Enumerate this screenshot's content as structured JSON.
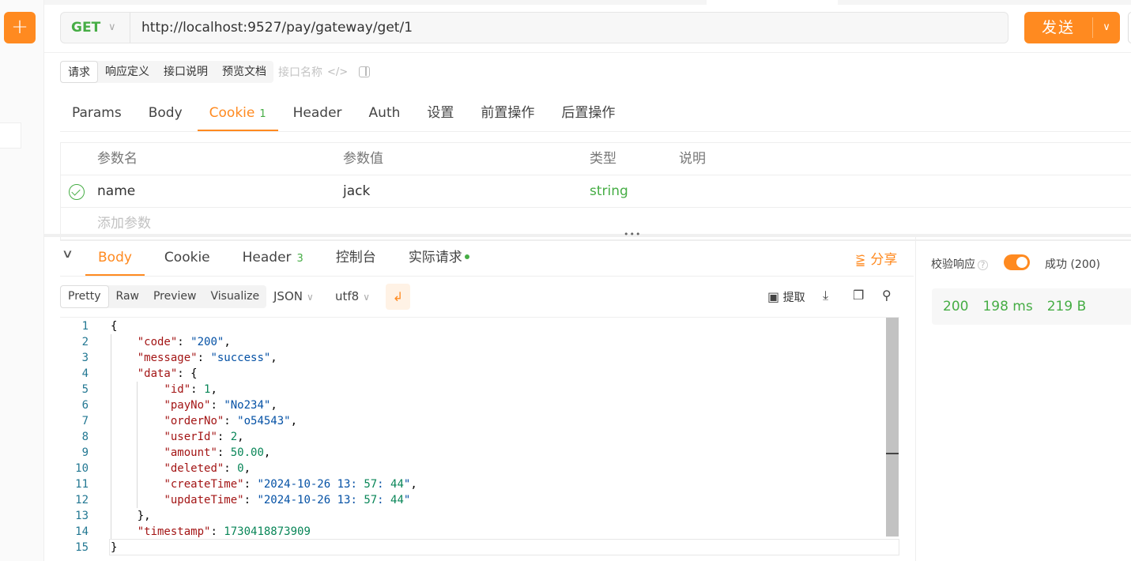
{
  "toolbar": {
    "add_icon": "plus-icon",
    "method": "GET",
    "url": "http://localhost:9527/pay/gateway/get/1",
    "send_label": "发送"
  },
  "request_tabs": {
    "items": [
      "请求",
      "响应定义",
      "接口说明",
      "预览文档"
    ],
    "api_name_placeholder": "接口名称"
  },
  "param_tabs": [
    {
      "label": "Params",
      "count": ""
    },
    {
      "label": "Body",
      "count": ""
    },
    {
      "label": "Cookie",
      "count": "1"
    },
    {
      "label": "Header",
      "count": ""
    },
    {
      "label": "Auth",
      "count": ""
    },
    {
      "label": "设置",
      "count": ""
    },
    {
      "label": "前置操作",
      "count": ""
    },
    {
      "label": "后置操作",
      "count": ""
    }
  ],
  "params_table": {
    "headers": [
      "参数名",
      "参数值",
      "类型",
      "说明"
    ],
    "rows": [
      {
        "name": "name",
        "value": "jack",
        "type": "string",
        "desc": ""
      }
    ],
    "add_placeholder": "添加参数"
  },
  "response_tabs": [
    {
      "label": "Body",
      "count": ""
    },
    {
      "label": "Cookie",
      "count": ""
    },
    {
      "label": "Header",
      "count": "3"
    },
    {
      "label": "控制台",
      "count": ""
    },
    {
      "label": "实际请求",
      "count": ""
    }
  ],
  "share_label": "分享",
  "format_tabs": [
    "Pretty",
    "Raw",
    "Preview",
    "Visualize"
  ],
  "format_dropdown": "JSON",
  "encoding_dropdown": "utf8",
  "extract_label": "提取",
  "code_lines": [
    "{",
    "    \"code\": \"200\",",
    "    \"message\": \"success\",",
    "    \"data\": {",
    "        \"id\": 1,",
    "        \"payNo\": \"No234\",",
    "        \"orderNo\": \"o54543\",",
    "        \"userId\": 2,",
    "        \"amount\": 50.00,",
    "        \"deleted\": 0,",
    "        \"createTime\": \"2024-10-26 13:57:44\",",
    "        \"updateTime\": \"2024-10-26 13:57:44\"",
    "    },",
    "    \"timestamp\": 1730418873909",
    "}"
  ],
  "verify": {
    "label": "校验响应",
    "help": "?",
    "enabled": true,
    "result": "成功 (200)"
  },
  "stats": {
    "status": "200",
    "time": "198 ms",
    "size": "219 B"
  },
  "colors": {
    "accent": "#ff8a20",
    "success": "#46ad45"
  }
}
